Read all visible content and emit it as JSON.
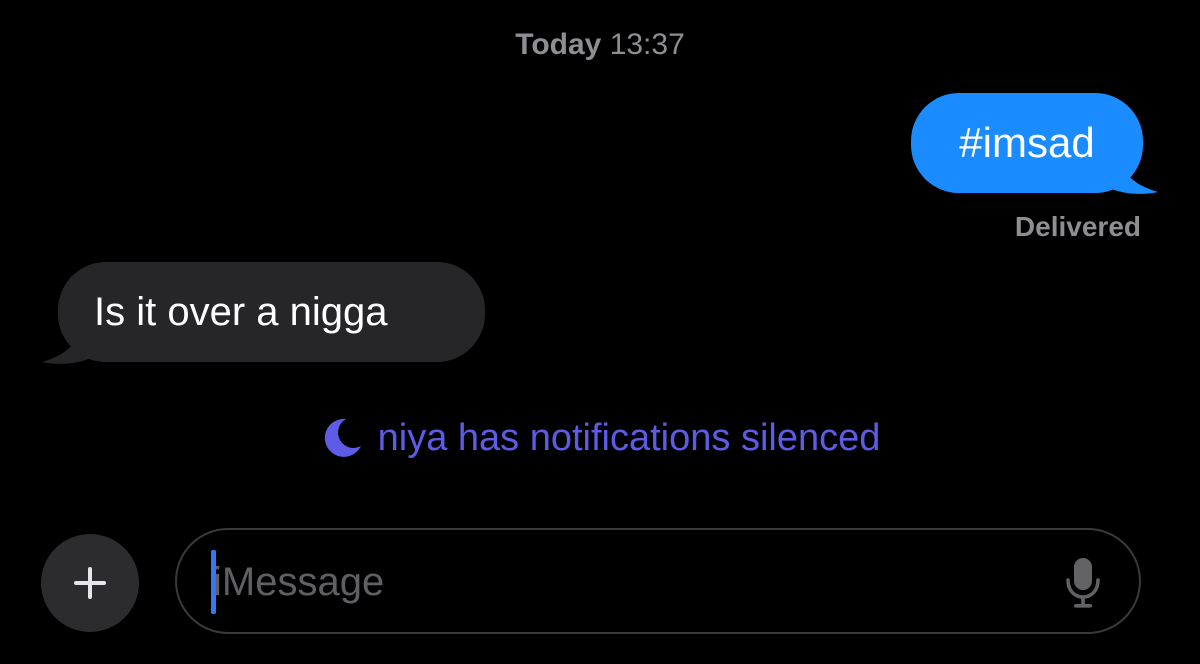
{
  "header": {
    "day": "Today",
    "time": "13:37"
  },
  "messages": [
    {
      "direction": "outgoing",
      "text": "#imsad"
    },
    {
      "direction": "incoming",
      "text": "Is it over a nigga"
    }
  ],
  "delivery_status": "Delivered",
  "focus_notice": {
    "icon": "moon-icon",
    "text": "niya has notifications silenced"
  },
  "composer": {
    "placeholder": "iMessage",
    "add_icon": "plus-icon",
    "mic_icon": "microphone-icon"
  },
  "colors": {
    "background": "#000000",
    "outgoing_bubble": "#1a8cff",
    "incoming_bubble": "#262628",
    "focus_purple": "#5e5ce6",
    "secondary_text": "#8e8e93",
    "cursor": "#3478f6"
  }
}
